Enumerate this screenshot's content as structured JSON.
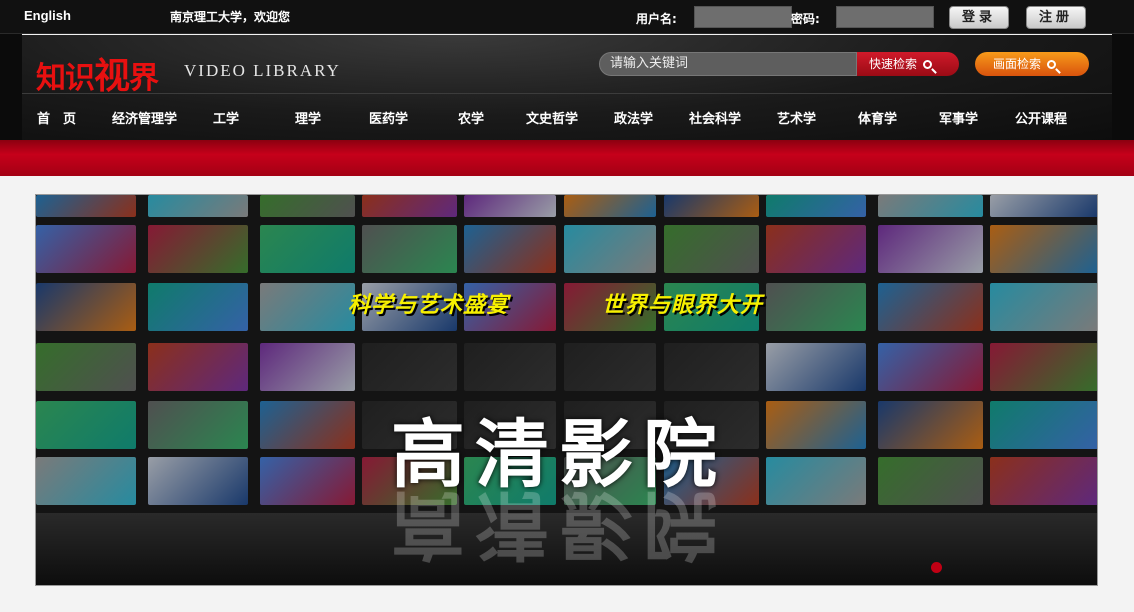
{
  "topbar": {
    "english_link": "English",
    "welcome": "南京理工大学，欢迎您",
    "username_label": "用户名:",
    "password_label": "密码:",
    "login_button": "登录",
    "register_button": "注册"
  },
  "header": {
    "logo_cn_1": "知识",
    "logo_cn_2": "视",
    "logo_cn_3": "界",
    "logo_en": "VIDEO LIBRARY",
    "search_placeholder": "请输入关键词",
    "quick_search": "快速检索",
    "image_search": "画面检索"
  },
  "nav": {
    "items": [
      "首　页",
      "经济管理学",
      "工学",
      "理学",
      "医药学",
      "农学",
      "文史哲学",
      "政法学",
      "社会科学",
      "艺术学",
      "体育学",
      "军事学",
      "公开课程"
    ]
  },
  "banner": {
    "tagline_1": "科学与艺术盛宴",
    "tagline_2": "世界与眼界大开",
    "headline": "高清影院"
  },
  "colors": {
    "accent_red": "#c6001a",
    "logo_red": "#e81010",
    "tagline_yellow": "#f7f000",
    "image_search_orange": "#f07a14"
  }
}
